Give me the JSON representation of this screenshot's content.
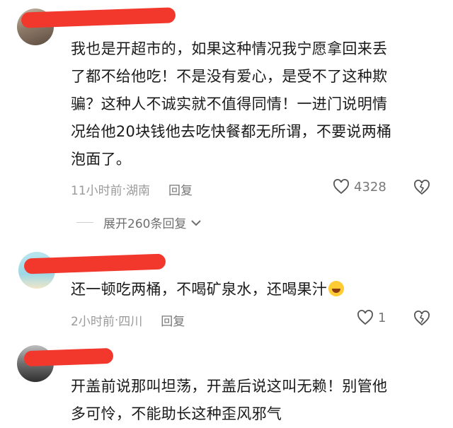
{
  "comments": [
    {
      "text_lines": [
        "我也是开超市的，如果这种情况我宁愿拿回来丢",
        "了都不给他吃！不是没有爱心，是受不了这种欺",
        "骗？这种人不诚实就不值得同情！一进门说明情",
        "况给他20块钱他去吃快餐都无所谓，不要说两桶",
        "泡面了。"
      ],
      "time": "11小时前",
      "location": "湖南",
      "reply_label": "回复",
      "likes": "4328",
      "expand_label": "展开260条回复"
    },
    {
      "text_lines": [
        "还一顿吃两桶，不喝矿泉水，还喝果汁"
      ],
      "emoji": "laughing-tears",
      "time": "2小时前",
      "location": "四川",
      "reply_label": "回复",
      "likes": "1"
    },
    {
      "text_lines": [
        "开盖前说那叫坦荡，开盖后说这叫无赖！别管他",
        "多可怜，不能助长这种歪风邪气"
      ]
    }
  ],
  "separator": " · ",
  "colors": {
    "redaction": "#f2372c",
    "meta": "#9a9a9a",
    "text": "#1a1a1a"
  }
}
